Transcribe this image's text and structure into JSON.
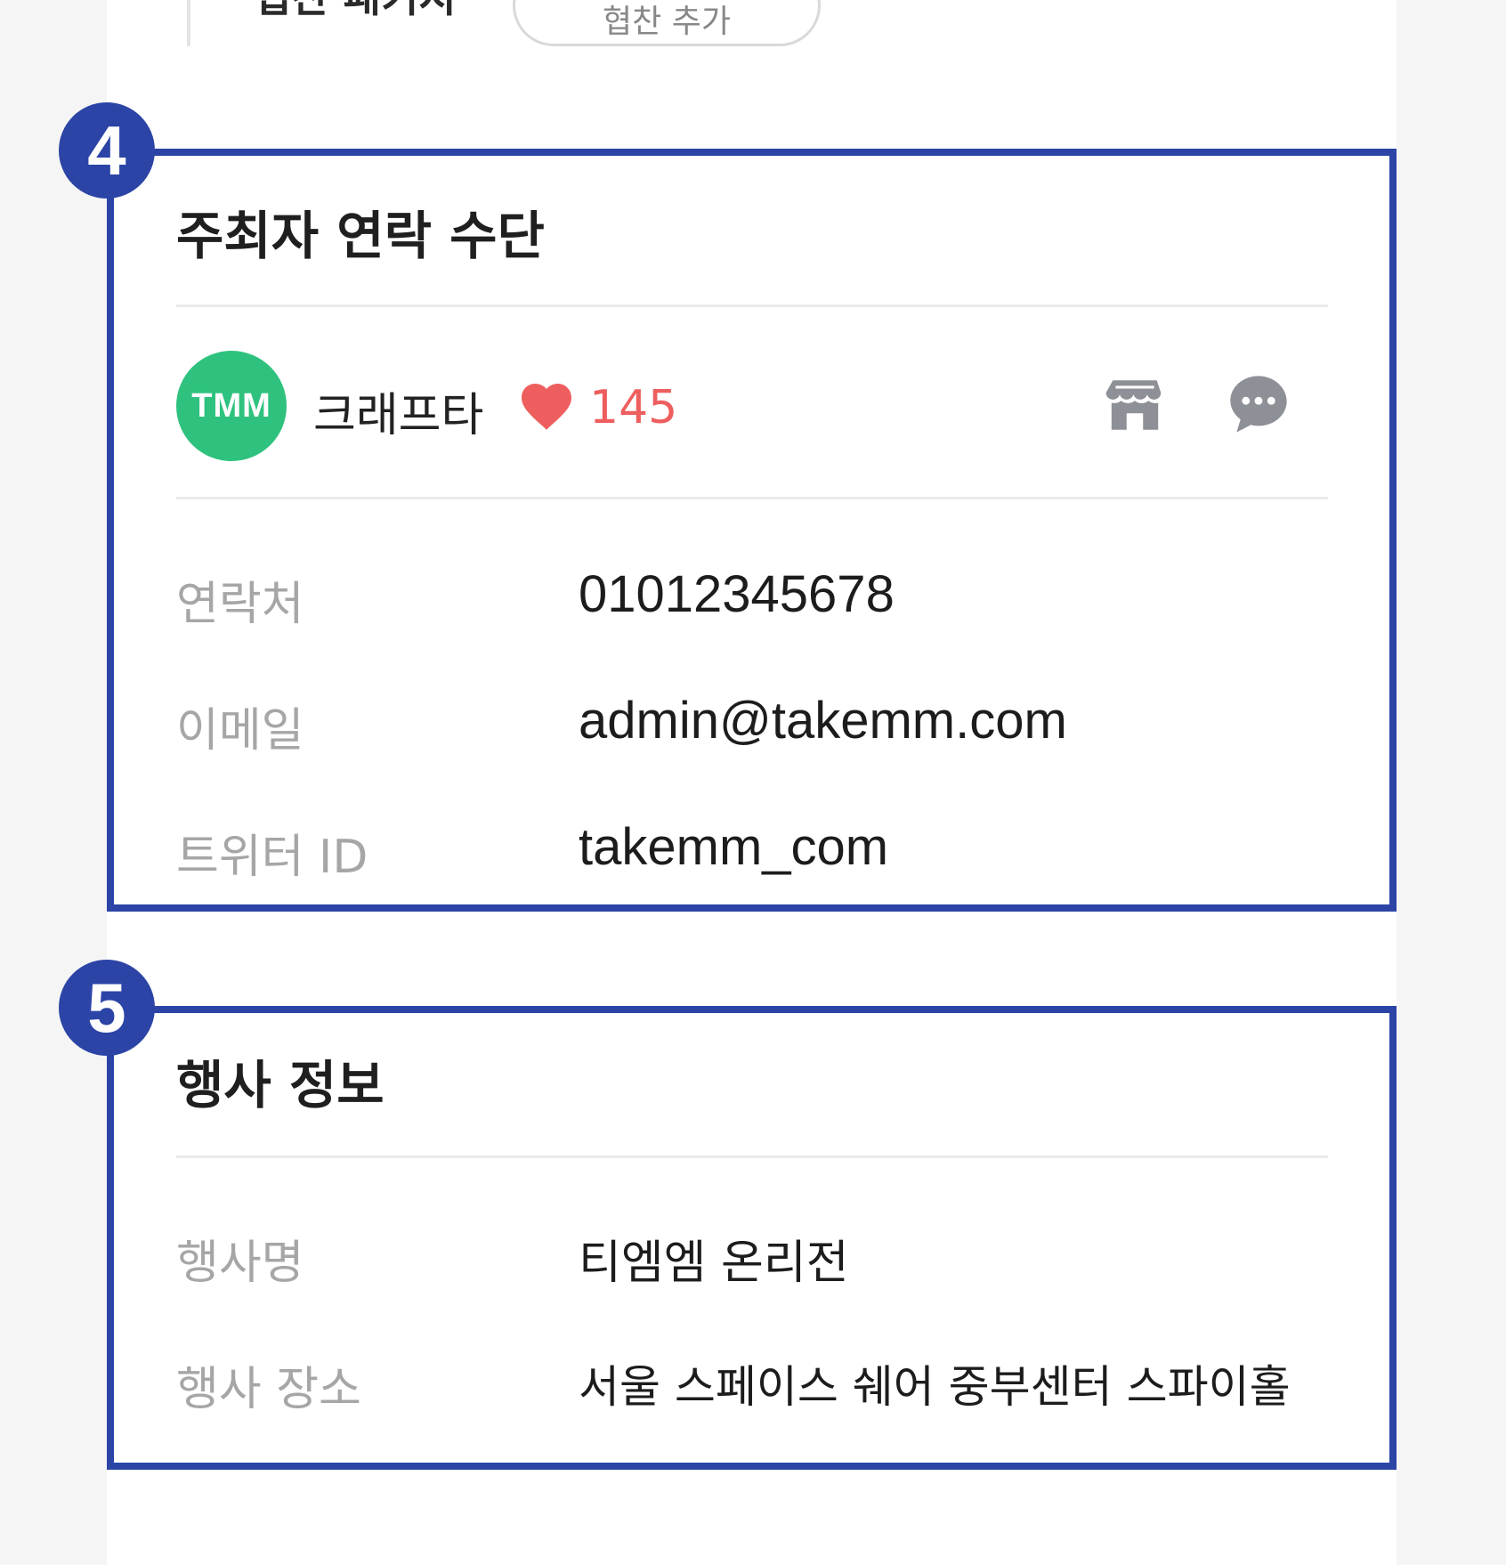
{
  "top": {
    "label": "협찬 패키지",
    "pill": "협찬 추가"
  },
  "annotations": {
    "badge_4": "4",
    "badge_5": "5"
  },
  "contact": {
    "title": "주최자 연락 수단",
    "organizer": {
      "avatar_text": "TMM",
      "name": "크래프타",
      "likes": "145",
      "store_icon": "store-icon",
      "chat_icon": "chat-bubble-icon"
    },
    "rows": [
      {
        "label": "연락처",
        "value": "01012345678"
      },
      {
        "label": "이메일",
        "value": "admin@takemm.com"
      },
      {
        "label": "트위터 ID",
        "value": "takemm_com"
      }
    ]
  },
  "event": {
    "title": "행사 정보",
    "rows": [
      {
        "label": "행사명",
        "value": "티엠엠 온리전"
      },
      {
        "label": "행사 장소",
        "value": "서울 스페이스 쉐어 중부센터 스파이홀"
      }
    ]
  },
  "colors": {
    "accent_frame": "#2b44a6",
    "avatar_bg": "#2ec27e",
    "like": "#ee5e5e",
    "icon_gray": "#8e9097"
  }
}
